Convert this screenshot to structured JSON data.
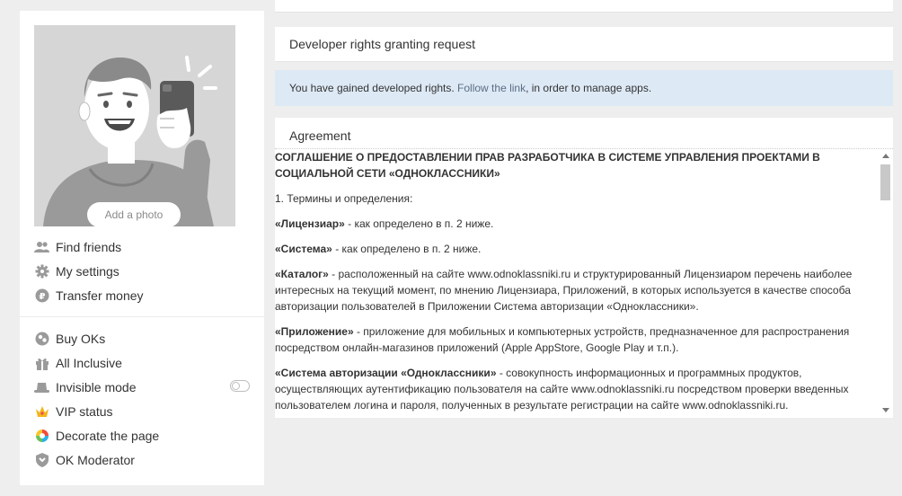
{
  "profile": {
    "add_photo_label": "Add a photo"
  },
  "menu_primary": [
    {
      "label": "Find friends",
      "icon": "friends-icon"
    },
    {
      "label": "My settings",
      "icon": "gear-icon"
    },
    {
      "label": "Transfer money",
      "icon": "ruble-icon"
    }
  ],
  "menu_secondary": [
    {
      "label": "Buy OKs",
      "icon": "coins-icon"
    },
    {
      "label": "All Inclusive",
      "icon": "gift-icon"
    },
    {
      "label": "Invisible mode",
      "icon": "hat-icon",
      "toggle": "off"
    },
    {
      "label": "VIP status",
      "icon": "crown-icon"
    },
    {
      "label": "Decorate the page",
      "icon": "palette-icon"
    },
    {
      "label": "OK Moderator",
      "icon": "shield-icon"
    }
  ],
  "page": {
    "title": "Developer rights granting request",
    "notice_before": "You have gained developed rights. ",
    "notice_link": "Follow the link",
    "notice_after": ", in order to manage apps.",
    "agreement_header": "Agreement"
  },
  "agreement": {
    "title": "СОГЛАШЕНИЕ О ПРЕДОСТАВЛЕНИИ ПРАВ РАЗРАБОТЧИКА В СИСТЕМЕ УПРАВЛЕНИЯ ПРОЕКТАМИ В СОЦИАЛЬНОЙ СЕТИ «ОДНОКЛАССНИКИ»",
    "section1": "1. Термины и определения:",
    "terms": [
      {
        "term": "«Лицензиар»",
        "definition": " - как определено в п. 2 ниже."
      },
      {
        "term": "«Система»",
        "definition": " - как определено в п. 2 ниже."
      },
      {
        "term": "«Каталог»",
        "definition": " - расположенный на сайте www.odnoklassniki.ru и структурированный Лицензиаром перечень наиболее интересных на текущий момент, по мнению Лицензиара, Приложений, в которых используется в качестве способа авторизации пользователей в Приложении Система авторизации «Одноклассники»."
      },
      {
        "term": "«Приложение»",
        "definition": " - приложение для мобильных и компьютерных устройств, предназначенное для распространения посредством онлайн-магазинов приложений (Apple AppStore, Google Play и т.п.)."
      },
      {
        "term": "«Система авторизации «Одноклассники»",
        "definition": " - совокупность информационных и программных продуктов, осуществляющих аутентификацию пользователя на сайте www.odnoklassniki.ru посредством проверки введенных пользователем логина и пароля, полученных в результате регистрации на сайте www.odnoklassniki.ru."
      }
    ]
  },
  "colors": {
    "background": "#eeeeee",
    "notice_bg": "#dde9f5",
    "link": "#5a6e83",
    "avatar_bg": "#d6d6d6"
  }
}
